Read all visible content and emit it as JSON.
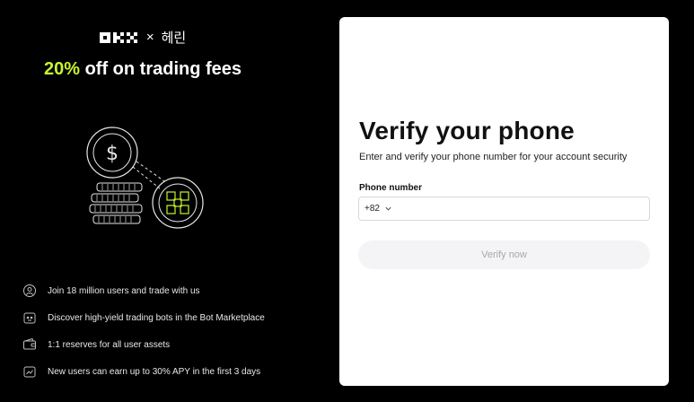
{
  "brand": {
    "logo_icon": "okx-logo",
    "separator": "×",
    "partner": "헤린"
  },
  "promo": {
    "highlight": "20%",
    "rest": " off on trading fees",
    "highlight_color": "#c6f432"
  },
  "features": [
    {
      "icon": "users-globe-icon",
      "text": "Join 18 million users and trade with us"
    },
    {
      "icon": "bot-icon",
      "text": "Discover high-yield trading bots in the Bot Marketplace"
    },
    {
      "icon": "wallet-icon",
      "text": "1:1 reserves for all user assets"
    },
    {
      "icon": "apy-gift-icon",
      "text": "New users can earn up to 30% APY in the first 3 days"
    }
  ],
  "form": {
    "title": "Verify your phone",
    "subtitle": "Enter and verify your phone number for your account security",
    "phone_label": "Phone number",
    "country_code": "+82",
    "phone_value": "",
    "phone_placeholder": "",
    "submit_label": "Verify now"
  }
}
